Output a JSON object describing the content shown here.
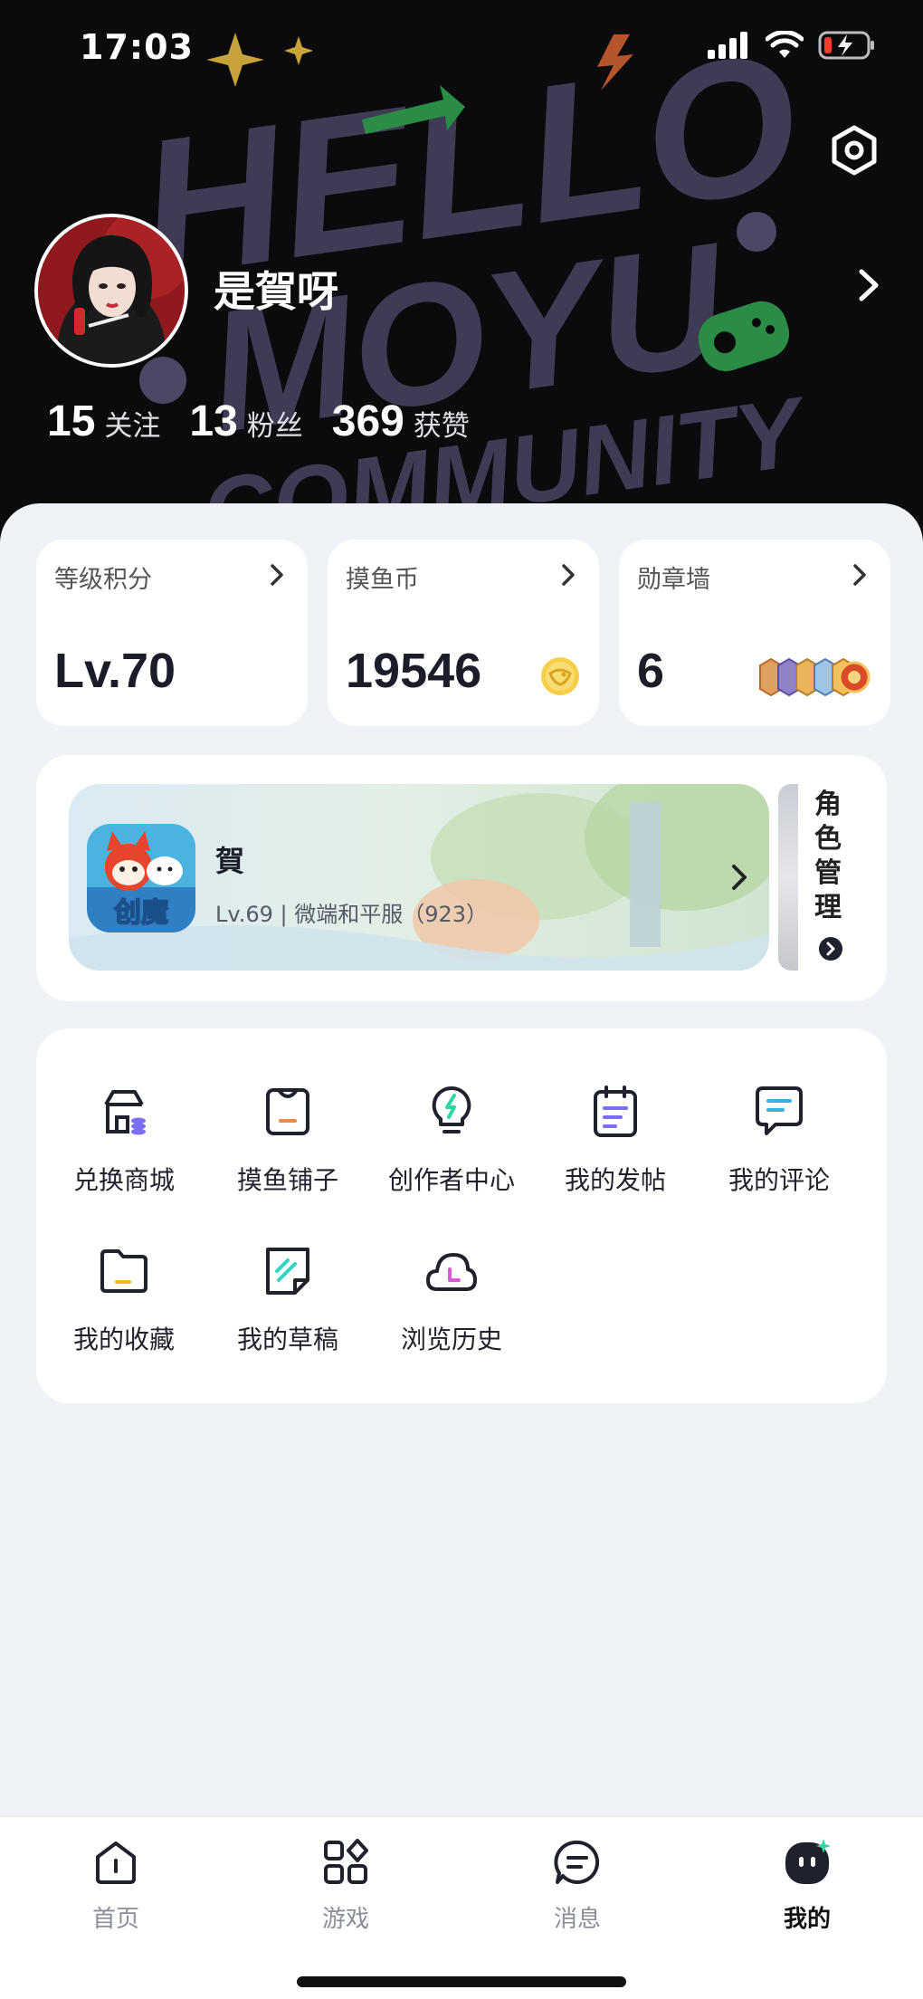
{
  "status_bar": {
    "time": "17:03"
  },
  "header": {
    "background_text": [
      "HELLO",
      "MOYU",
      "COMMUNITY"
    ],
    "username": "是賀呀"
  },
  "stats": [
    {
      "value": "15",
      "label": "关注"
    },
    {
      "value": "13",
      "label": "粉丝"
    },
    {
      "value": "369",
      "label": "获赞"
    }
  ],
  "cards": [
    {
      "title": "等级积分",
      "value": "Lv.70",
      "icon": "level-icon"
    },
    {
      "title": "摸鱼币",
      "value": "19546",
      "icon": "coin-icon"
    },
    {
      "title": "勋章墙",
      "value": "6",
      "icon": "medals-icon"
    }
  ],
  "role": {
    "name": "賀",
    "info": "Lv.69 | 微端和平服（923）",
    "manage_label": "角色管理",
    "game_icon_text": "创魔"
  },
  "menu": [
    {
      "label": "兑换商城",
      "icon": "shop-icon"
    },
    {
      "label": "摸鱼铺子",
      "icon": "store-bag-icon"
    },
    {
      "label": "创作者中心",
      "icon": "lightbulb-icon"
    },
    {
      "label": "我的发帖",
      "icon": "post-note-icon"
    },
    {
      "label": "我的评论",
      "icon": "comment-icon"
    },
    {
      "label": "我的收藏",
      "icon": "folder-icon"
    },
    {
      "label": "我的草稿",
      "icon": "draft-icon"
    },
    {
      "label": "浏览历史",
      "icon": "history-cloud-icon"
    }
  ],
  "tabs": [
    {
      "label": "首页",
      "icon": "home-icon",
      "active": false
    },
    {
      "label": "游戏",
      "icon": "games-grid-icon",
      "active": false
    },
    {
      "label": "消息",
      "icon": "message-icon",
      "active": false
    },
    {
      "label": "我的",
      "icon": "profile-face-icon",
      "active": true
    }
  ],
  "colors": {
    "header_bg": "#0b0b0e",
    "page_bg": "#eff3f7",
    "card_bg": "#ffffff",
    "accent_green": "#2fd6a0",
    "icon_dark": "#1f222c"
  }
}
